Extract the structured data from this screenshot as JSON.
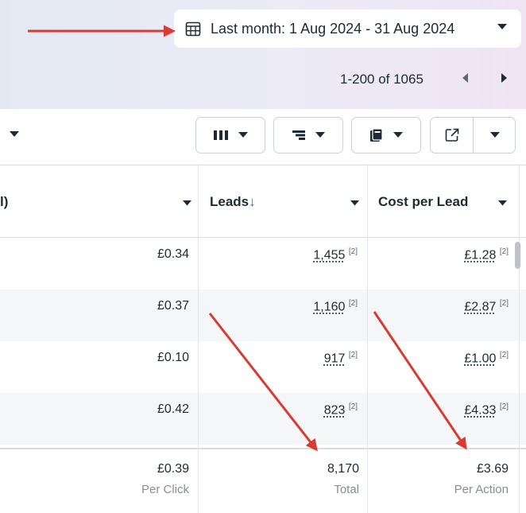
{
  "date_range": {
    "label": "Last month: 1 Aug 2024 - 31 Aug 2024",
    "icon": "calendar-icon"
  },
  "pagination": {
    "label": "1-200 of 1065"
  },
  "table": {
    "headers": {
      "first_col": "l)",
      "leads": "Leads",
      "leads_sort_arrow": "↓",
      "cost_per_lead": "Cost per Lead"
    },
    "rows": [
      {
        "cpc": "£0.34",
        "leads": "1,455",
        "leads_note": "[2]",
        "cpl": "£1.28",
        "cpl_note": "[2]"
      },
      {
        "cpc": "£0.37",
        "leads": "1,160",
        "leads_note": "[2]",
        "cpl": "£2.87",
        "cpl_note": "[2]"
      },
      {
        "cpc": "£0.10",
        "leads": "917",
        "leads_note": "[2]",
        "cpl": "£1.00",
        "cpl_note": "[2]"
      },
      {
        "cpc": "£0.42",
        "leads": "823",
        "leads_note": "[2]",
        "cpl": "£4.33",
        "cpl_note": "[2]"
      }
    ],
    "totals": {
      "cpc": "£0.39",
      "cpc_sub": "Per Click",
      "leads": "8,170",
      "leads_sub": "Total",
      "cpl": "£3.69",
      "cpl_sub": "Per Action"
    }
  },
  "colors": {
    "annotation_arrow": "#d93a32",
    "sort_arrow": "#1877f2"
  }
}
